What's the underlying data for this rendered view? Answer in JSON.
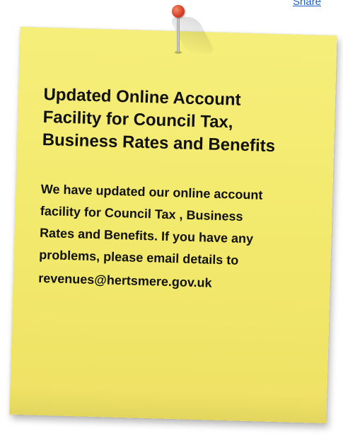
{
  "header": {
    "share_link_label": "Share"
  },
  "note": {
    "title": "Updated Online Account Facility for Council Tax, Business Rates and Benefits",
    "body_text": "We have updated our online account facility for Council Tax , Business Rates and Benefits. If you have any problems, please email details to",
    "email": "revenues@hertsmere.gov.uk",
    "background_color": "#f3eb70",
    "pin_color": "#d8432c"
  }
}
